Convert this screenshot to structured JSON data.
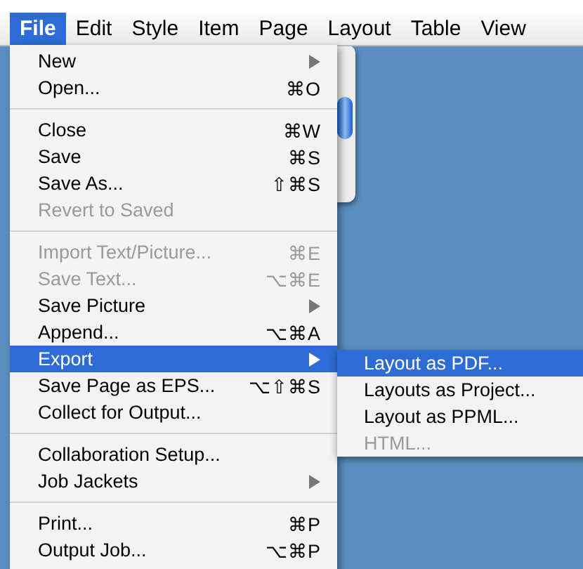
{
  "menu_bar": [
    {
      "label": "File",
      "selected": true
    },
    {
      "label": "Edit",
      "selected": false
    },
    {
      "label": "Style",
      "selected": false
    },
    {
      "label": "Item",
      "selected": false
    },
    {
      "label": "Page",
      "selected": false
    },
    {
      "label": "Layout",
      "selected": false
    },
    {
      "label": "Table",
      "selected": false
    },
    {
      "label": "View",
      "selected": false
    }
  ],
  "file_menu": {
    "items": [
      {
        "kind": "item",
        "label": "New",
        "submenu": true,
        "disabled": false,
        "selected": false
      },
      {
        "kind": "item",
        "label": "Open...",
        "shortcut": "⌘O",
        "disabled": false,
        "selected": false
      },
      {
        "kind": "separator"
      },
      {
        "kind": "item",
        "label": "Close",
        "shortcut": "⌘W",
        "disabled": false,
        "selected": false
      },
      {
        "kind": "item",
        "label": "Save",
        "shortcut": "⌘S",
        "disabled": false,
        "selected": false
      },
      {
        "kind": "item",
        "label": "Save As...",
        "shortcut": "⇧⌘S",
        "disabled": false,
        "selected": false
      },
      {
        "kind": "item",
        "label": "Revert to Saved",
        "disabled": true,
        "selected": false
      },
      {
        "kind": "separator"
      },
      {
        "kind": "item",
        "label": "Import Text/Picture...",
        "shortcut": "⌘E",
        "disabled": true,
        "selected": false
      },
      {
        "kind": "item",
        "label": "Save Text...",
        "shortcut": "⌥⌘E",
        "disabled": true,
        "selected": false
      },
      {
        "kind": "item",
        "label": "Save Picture",
        "submenu": true,
        "disabled": false,
        "selected": false
      },
      {
        "kind": "item",
        "label": "Append...",
        "shortcut": "⌥⌘A",
        "disabled": false,
        "selected": false
      },
      {
        "kind": "item",
        "label": "Export",
        "submenu": true,
        "disabled": false,
        "selected": true
      },
      {
        "kind": "item",
        "label": "Save Page as EPS...",
        "shortcut": "⌥⇧⌘S",
        "disabled": false,
        "selected": false
      },
      {
        "kind": "item",
        "label": "Collect for Output...",
        "disabled": false,
        "selected": false
      },
      {
        "kind": "separator"
      },
      {
        "kind": "item",
        "label": "Collaboration Setup...",
        "disabled": false,
        "selected": false
      },
      {
        "kind": "item",
        "label": "Job Jackets",
        "submenu": true,
        "disabled": false,
        "selected": false
      },
      {
        "kind": "separator"
      },
      {
        "kind": "item",
        "label": "Print...",
        "shortcut": "⌘P",
        "disabled": false,
        "selected": false
      },
      {
        "kind": "item",
        "label": "Output Job...",
        "shortcut": "⌥⌘P",
        "disabled": false,
        "selected": false
      }
    ]
  },
  "export_submenu": {
    "items": [
      {
        "label": "Layout as PDF...",
        "disabled": false,
        "selected": true
      },
      {
        "label": "Layouts as Project...",
        "disabled": false,
        "selected": false
      },
      {
        "label": "Layout as PPML...",
        "disabled": false,
        "selected": false
      },
      {
        "label": "HTML...",
        "disabled": true,
        "selected": false
      }
    ]
  }
}
